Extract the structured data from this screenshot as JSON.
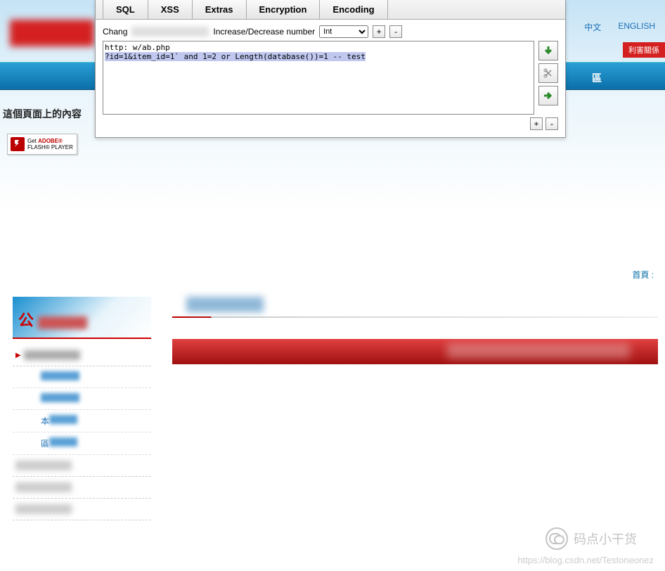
{
  "extension": {
    "tabs": [
      "SQL",
      "XSS",
      "Extras",
      "Encryption",
      "Encoding"
    ],
    "change_label": "Chang",
    "incdec_label": "Increase/Decrease number",
    "select_value": "Int",
    "plus": "+",
    "minus": "-",
    "textarea_line1": "http:              w/ab.php",
    "textarea_line2": "?id=1&item_id=1` and 1=2 or Length(database())=1 -- test"
  },
  "site": {
    "lang_zh": "中文",
    "lang_en": "ENGLISH",
    "red_badge": "利害關係",
    "nav_label": "區",
    "subtext": "這個頁面上的內容",
    "flash_get": "Get",
    "flash_adobe": "ADOBE®",
    "flash_player": "FLASH® PLAYER",
    "breadcrumb": "首頁 :"
  },
  "sidebar": {
    "header_char": "公",
    "sub_b": "本",
    "sub_c": "區"
  },
  "watermark": {
    "text": "码点小干货",
    "url": "https://blog.csdn.net/Testoneonez"
  }
}
